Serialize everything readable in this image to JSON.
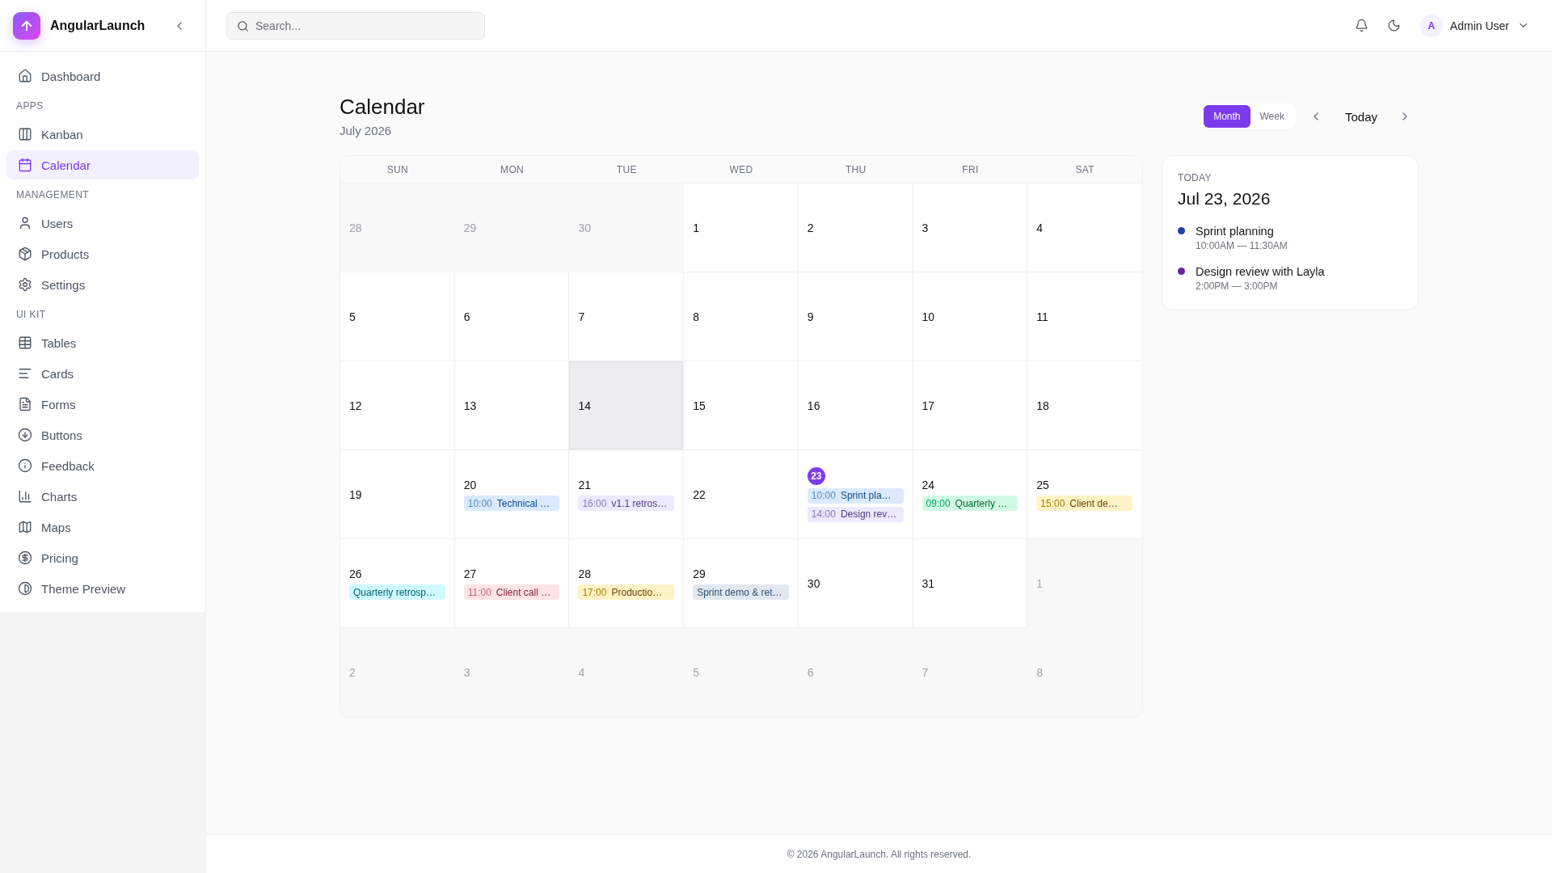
{
  "sidebar": {
    "brand": "AngularLaunch",
    "sections": [
      {
        "items": [
          {
            "label": "Dashboard",
            "selected": false
          }
        ]
      },
      {
        "title": "APPS",
        "items": [
          {
            "label": "Kanban",
            "selected": false
          },
          {
            "label": "Calendar",
            "selected": true
          }
        ]
      },
      {
        "title": "MANAGEMENT",
        "items": [
          {
            "label": "Users",
            "selected": false
          },
          {
            "label": "Products",
            "selected": false
          },
          {
            "label": "Settings",
            "selected": false
          }
        ]
      },
      {
        "title": "UI KIT",
        "items": [
          {
            "label": "Tables",
            "selected": false
          },
          {
            "label": "Cards",
            "selected": false
          },
          {
            "label": "Forms",
            "selected": false
          },
          {
            "label": "Buttons",
            "selected": false
          },
          {
            "label": "Feedback",
            "selected": false
          },
          {
            "label": "Charts",
            "selected": false
          },
          {
            "label": "Maps",
            "selected": false
          },
          {
            "label": "Pricing",
            "selected": false
          },
          {
            "label": "Theme Preview",
            "selected": false
          }
        ]
      }
    ]
  },
  "top_bar": {
    "search": {
      "placeholder": "Search..."
    },
    "user": {
      "initial": "A",
      "name": "Admin User"
    }
  },
  "page": {
    "title": "Calendar",
    "subtitle": "July 2026"
  },
  "toolbar": {
    "views": [
      {
        "label": "Month",
        "selected": true
      },
      {
        "label": "Week",
        "selected": false
      }
    ],
    "today_button": "Today"
  },
  "calendar": {
    "weekdays": [
      "SUN",
      "MON",
      "TUE",
      "WED",
      "THU",
      "FRI",
      "SAT"
    ],
    "weeks": [
      {
        "days": [
          {
            "day": "28",
            "in_month": false,
            "selected": false,
            "today": false
          },
          {
            "day": "29",
            "in_month": false,
            "selected": false,
            "today": false
          },
          {
            "day": "30",
            "in_month": false,
            "selected": false,
            "today": false
          },
          {
            "day": "1",
            "in_month": true,
            "selected": false,
            "today": false
          },
          {
            "day": "2",
            "in_month": true,
            "selected": false,
            "today": false
          },
          {
            "day": "3",
            "in_month": true,
            "selected": false,
            "today": false
          },
          {
            "day": "4",
            "in_month": true,
            "selected": false,
            "today": false
          }
        ]
      },
      {
        "days": [
          {
            "day": "5",
            "in_month": true,
            "selected": false,
            "today": false
          },
          {
            "day": "6",
            "in_month": true,
            "selected": false,
            "today": false
          },
          {
            "day": "7",
            "in_month": true,
            "selected": false,
            "today": false
          },
          {
            "day": "8",
            "in_month": true,
            "selected": false,
            "today": false
          },
          {
            "day": "9",
            "in_month": true,
            "selected": false,
            "today": false
          },
          {
            "day": "10",
            "in_month": true,
            "selected": false,
            "today": false
          },
          {
            "day": "11",
            "in_month": true,
            "selected": false,
            "today": false
          }
        ]
      },
      {
        "days": [
          {
            "day": "12",
            "in_month": true,
            "selected": false,
            "today": false
          },
          {
            "day": "13",
            "in_month": true,
            "selected": false,
            "today": false
          },
          {
            "day": "14",
            "in_month": true,
            "selected": true,
            "today": false
          },
          {
            "day": "15",
            "in_month": true,
            "selected": false,
            "today": false
          },
          {
            "day": "16",
            "in_month": true,
            "selected": false,
            "today": false
          },
          {
            "day": "17",
            "in_month": true,
            "selected": false,
            "today": false
          },
          {
            "day": "18",
            "in_month": true,
            "selected": false,
            "today": false
          }
        ]
      },
      {
        "days": [
          {
            "day": "19",
            "in_month": true,
            "selected": false,
            "today": false
          },
          {
            "day": "20",
            "in_month": true,
            "selected": false,
            "today": false,
            "events": [
              {
                "time": "10:00",
                "title": "Technical …",
                "color": "#dbeafe"
              }
            ]
          },
          {
            "day": "21",
            "in_month": true,
            "selected": false,
            "today": false,
            "events": [
              {
                "time": "16:00",
                "title": "v1.1 retros…",
                "color": "#ede9fe"
              }
            ]
          },
          {
            "day": "22",
            "in_month": true,
            "selected": false,
            "today": false
          },
          {
            "day": "23",
            "in_month": true,
            "selected": false,
            "today": true,
            "events": [
              {
                "time": "10:00",
                "title": "Sprint pla…",
                "color": "#dbeafe"
              },
              {
                "time": "14:00",
                "title": "Design rev…",
                "color": "#ede9fe"
              }
            ]
          },
          {
            "day": "24",
            "in_month": true,
            "selected": false,
            "today": false,
            "events": [
              {
                "time": "09:00",
                "title": "Quarterly …",
                "color": "#d1fae5"
              }
            ]
          },
          {
            "day": "25",
            "in_month": true,
            "selected": false,
            "today": false,
            "events": [
              {
                "time": "15:00",
                "title": "Client de…",
                "color": "#fef3c7"
              }
            ]
          }
        ]
      },
      {
        "days": [
          {
            "day": "26",
            "in_month": true,
            "selected": false,
            "today": false,
            "events": [
              {
                "title": "Quarterly retrosp…",
                "color": "#cffafe"
              }
            ]
          },
          {
            "day": "27",
            "in_month": true,
            "selected": false,
            "today": false,
            "events": [
              {
                "time": "11:00",
                "title": "Client call …",
                "color": "#ffe4e6"
              }
            ]
          },
          {
            "day": "28",
            "in_month": true,
            "selected": false,
            "today": false,
            "events": [
              {
                "time": "17:00",
                "title": "Productio…",
                "color": "#fef3c7"
              }
            ]
          },
          {
            "day": "29",
            "in_month": true,
            "selected": false,
            "today": false,
            "events": [
              {
                "title": "Sprint demo & ret…",
                "color": "#e2e8f0"
              }
            ]
          },
          {
            "day": "30",
            "in_month": true,
            "selected": false,
            "today": false
          },
          {
            "day": "31",
            "in_month": true,
            "selected": false,
            "today": false
          },
          {
            "day": "1",
            "in_month": false,
            "selected": false,
            "today": false
          }
        ]
      },
      {
        "days": [
          {
            "day": "2",
            "in_month": false,
            "selected": false,
            "today": false
          },
          {
            "day": "3",
            "in_month": false,
            "selected": false,
            "today": false
          },
          {
            "day": "4",
            "in_month": false,
            "selected": false,
            "today": false
          },
          {
            "day": "5",
            "in_month": false,
            "selected": false,
            "today": false
          },
          {
            "day": "6",
            "in_month": false,
            "selected": false,
            "today": false
          },
          {
            "day": "7",
            "in_month": false,
            "selected": false,
            "today": false
          },
          {
            "day": "8",
            "in_month": false,
            "selected": false,
            "today": false
          }
        ]
      }
    ]
  },
  "today_panel": {
    "label": "TODAY",
    "date": "Jul 23, 2026",
    "events": [
      {
        "title": "Sprint planning",
        "time": "10:00AM — 11:30AM",
        "color": "#1e40af"
      },
      {
        "title": "Design review with Layla",
        "time": "2:00PM — 3:00PM",
        "color": "#6b21a8"
      }
    ]
  },
  "footer": {
    "text": "© 2026 AngularLaunch. All rights reserved."
  }
}
